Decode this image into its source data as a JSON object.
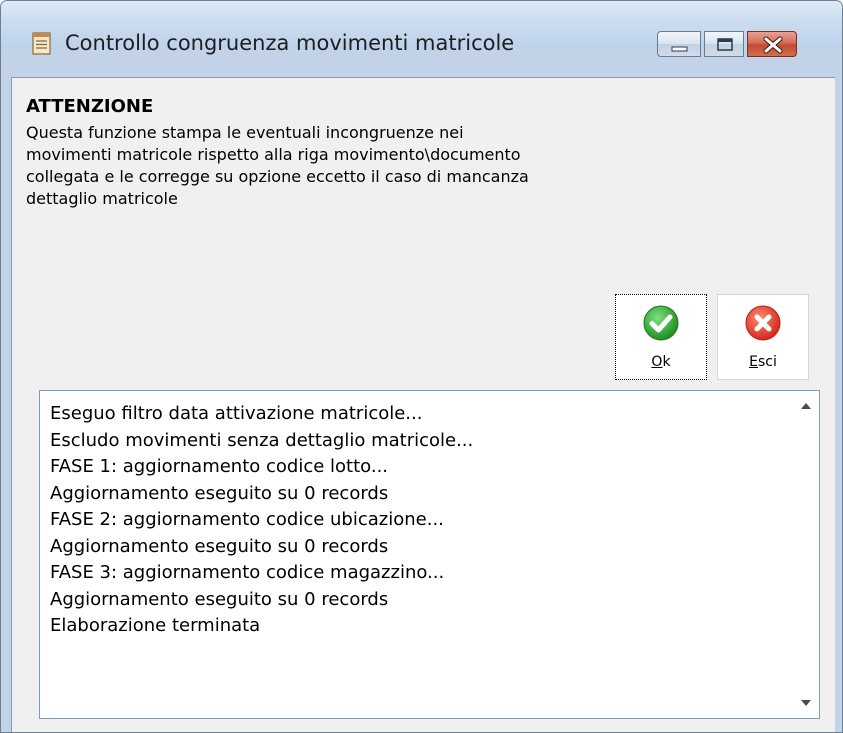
{
  "window": {
    "title": "Controllo congruenza movimenti matricole",
    "icons": {
      "app": "document-icon",
      "minimize": "minimize-icon",
      "maximize": "maximize-icon",
      "close": "close-icon"
    }
  },
  "notice": {
    "heading": "ATTENZIONE",
    "text": "Questa funzione stampa le eventuali incongruenze nei\nmovimenti matricole rispetto alla riga movimento\\documento\ncollegata e le corregge su opzione eccetto il caso di mancanza\ndettaglio matricole"
  },
  "buttons": {
    "ok": {
      "mnemonic": "O",
      "rest": "k",
      "icon": "check-icon",
      "color": "#2fa52f"
    },
    "esci": {
      "mnemonic": "E",
      "rest": "sci",
      "icon": "cancel-icon",
      "color": "#e0392b"
    }
  },
  "log": {
    "lines": [
      "Eseguo filtro data attivazione matricole...",
      "Escludo movimenti senza dettaglio matricole...",
      "FASE 1: aggiornamento codice lotto...",
      "Aggiornamento eseguito su 0 records",
      "FASE 2: aggiornamento codice ubicazione...",
      "Aggiornamento eseguito su 0 records",
      "FASE 3: aggiornamento codice magazzino...",
      "Aggiornamento eseguito su 0 records",
      "Elaborazione terminata"
    ]
  }
}
